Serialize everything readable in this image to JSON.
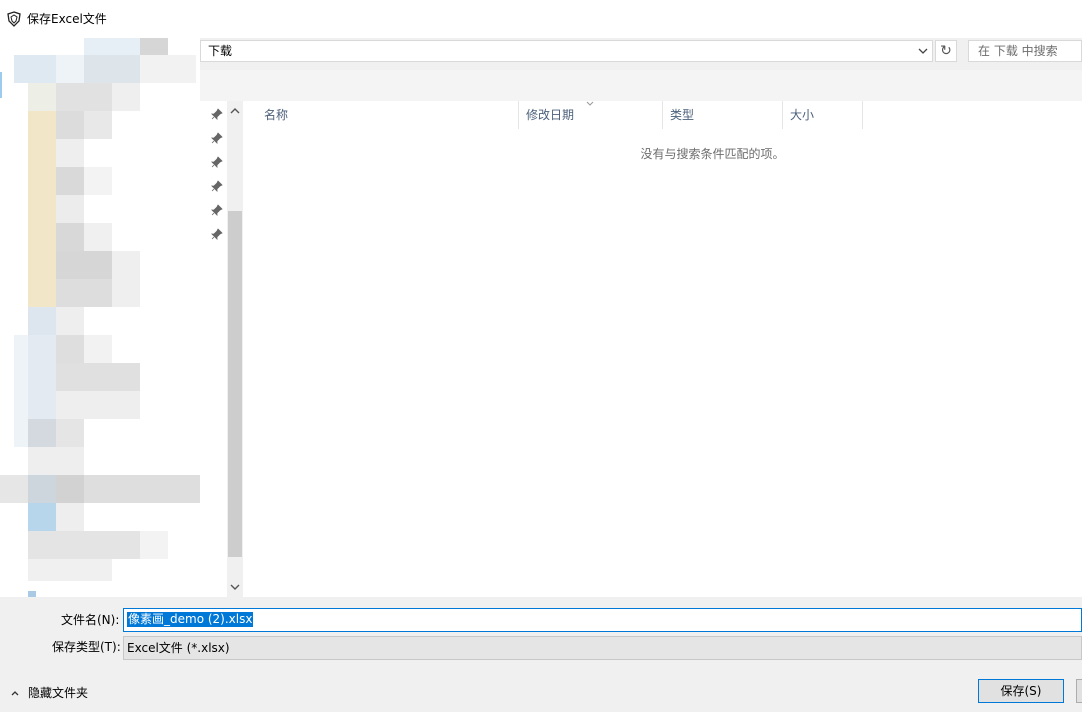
{
  "window": {
    "title": "保存Excel文件"
  },
  "address": {
    "path": "下载",
    "search_placeholder": "在 下载 中搜索",
    "refresh_glyph": "↻"
  },
  "file_list": {
    "columns": [
      "名称",
      "修改日期",
      "类型",
      "大小"
    ],
    "empty_message": "没有与搜索条件匹配的项。"
  },
  "form": {
    "filename_label": "文件名(N):",
    "filename_value": "像素画_demo (2).xlsx",
    "filetype_label": "保存类型(T):",
    "filetype_value": "Excel文件 (*.xlsx)"
  },
  "footer": {
    "hide_folders_label": "隐藏文件夹",
    "save_label": "保存(S)"
  },
  "icons": {
    "title": "app-shield-icon",
    "dropdown": "chevron-down-icon",
    "refresh": "refresh-icon",
    "pin": "pin-icon",
    "scroll_up": "chevron-up-icon",
    "scroll_down": "chevron-down-icon",
    "hide_folders": "chevron-up-icon"
  },
  "colors": {
    "accent": "#0078d7",
    "header_text": "#4c607a",
    "muted_text": "#6d6d6d"
  }
}
